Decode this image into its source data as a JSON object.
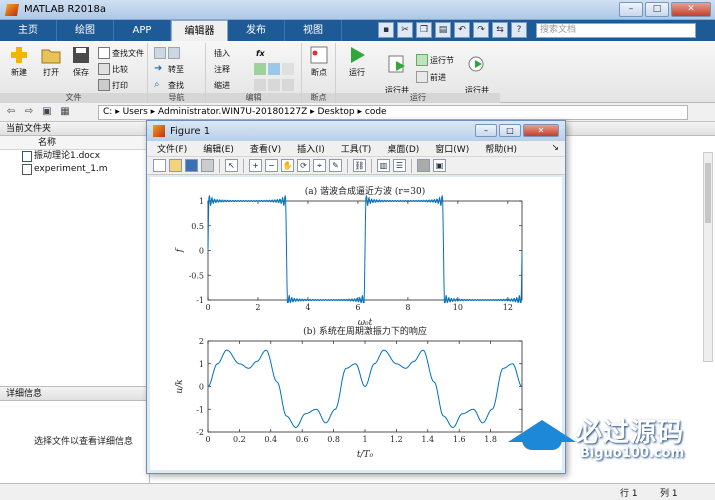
{
  "window": {
    "title": "MATLAB R2018a",
    "controls": [
      "–",
      "□",
      "✕"
    ]
  },
  "tabs": [
    "主页",
    "绘图",
    "APP",
    "编辑器",
    "发布",
    "视图"
  ],
  "active_tab": "编辑器",
  "search": {
    "placeholder": "搜索文档"
  },
  "ribbon": {
    "file_group": {
      "label": "文件",
      "new": "新建",
      "open": "打开",
      "save": "保存",
      "find_files": "查找文件",
      "compare": "比较",
      "print": "打印"
    },
    "nav_group": {
      "label": "导航",
      "goto": "转至",
      "find": "查找"
    },
    "edit_group": {
      "label": "编辑",
      "insert": "插入",
      "comment": "注释",
      "indent": "缩进",
      "fx": "fx"
    },
    "breakpoint_group": {
      "label": "断点",
      "breakpoints": "断点"
    },
    "run_group": {
      "label": "运行",
      "run": "运行",
      "run_advance": "运行并\n前进",
      "run_section": "运行节",
      "advance": "前进",
      "run_time": "运行并\n计时"
    }
  },
  "addressbar": {
    "path": [
      "C:",
      "Users",
      "Administrator.WIN7U-20180127Z",
      "Desktop",
      "code"
    ]
  },
  "current_folder": {
    "title": "当前文件夹",
    "column": "名称",
    "files": [
      "振动理论1.docx",
      "experiment_1.m"
    ]
  },
  "details": {
    "title": "详细信息",
    "message": "选择文件以查看详细信息"
  },
  "statusbar": {
    "row_label": "行",
    "row": "1",
    "col_label": "列",
    "col": "1"
  },
  "figure": {
    "title": "Figure 1",
    "menu": [
      "文件(F)",
      "编辑(E)",
      "查看(V)",
      "插入(I)",
      "工具(T)",
      "桌面(D)",
      "窗口(W)",
      "帮助(H)"
    ]
  },
  "chart_data": [
    {
      "type": "line",
      "title": "(a) 谐波合成逼近方波 (r=30)",
      "xlabel": "ω₀t",
      "ylabel": "f",
      "xlim": [
        0,
        12.566
      ],
      "ylim": [
        -1,
        1
      ],
      "xticks": [
        0,
        2,
        4,
        6,
        8,
        10,
        12
      ],
      "yticks": [
        -1,
        -0.5,
        0,
        0.5,
        1
      ],
      "series": [
        {
          "generator": "fourier_square",
          "harmonics": 30,
          "period": 6.2832,
          "color": "#0072bd"
        }
      ]
    },
    {
      "type": "line",
      "title": "(b) 系统在周期激振力下的响应",
      "xlabel": "t/T₀",
      "ylabel": "u/k",
      "xlim": [
        0,
        2
      ],
      "ylim": [
        -2,
        2
      ],
      "xticks": [
        0,
        0.2,
        0.4,
        0.6,
        0.8,
        1,
        1.2,
        1.4,
        1.6,
        1.8
      ],
      "yticks": [
        -2,
        -1,
        0,
        1,
        2
      ],
      "series": [
        {
          "generator": "response",
          "color": "#0072bd",
          "points_x": [
            0,
            0.06,
            0.12,
            0.2,
            0.26,
            0.31,
            0.37,
            0.44,
            0.5,
            0.56,
            0.62,
            0.69,
            0.75,
            0.81,
            0.88,
            0.94,
            1.0
          ],
          "points_y": [
            0.0,
            1.0,
            1.6,
            1.0,
            0.8,
            1.1,
            1.6,
            0.2,
            -1.3,
            -1.8,
            -1.2,
            -1.0,
            -1.6,
            -1.0,
            0.8,
            1.0,
            0.0
          ]
        }
      ]
    }
  ],
  "watermark": {
    "text": "必过源码",
    "url": "Biguo100.com"
  }
}
